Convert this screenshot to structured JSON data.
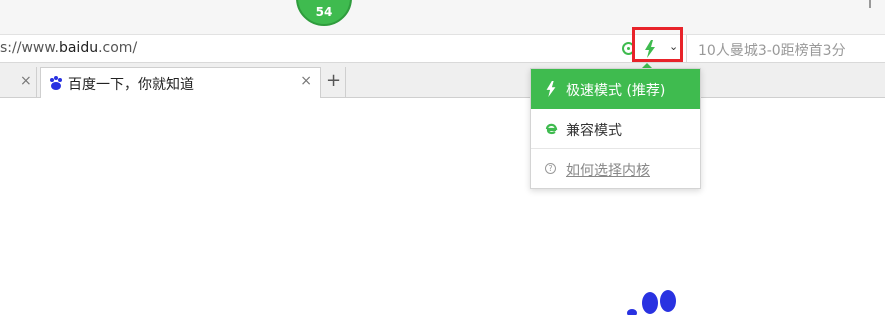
{
  "top_bar": {
    "badge_count": "54"
  },
  "address_bar": {
    "url_prefix": "s://www.",
    "url_host": "baidu",
    "url_suffix": ".com/",
    "search_text": "10人曼城3-0距榜首3分"
  },
  "tabs": {
    "items": [
      {
        "title": "百度一下，你就知道",
        "active": true
      }
    ],
    "close_glyph": "×",
    "new_tab_glyph": "+"
  },
  "mode_menu": {
    "items": [
      {
        "label": "极速模式 (推荐)",
        "selected": true,
        "icon": "bolt-icon"
      },
      {
        "label": "兼容模式",
        "selected": false,
        "icon": "ie-icon"
      },
      {
        "label": "如何选择内核",
        "selected": false,
        "icon": "help-icon"
      }
    ]
  },
  "colors": {
    "accent_green": "#3fbb4f",
    "highlight_red": "#e8232a",
    "baidu_blue": "#2932e1"
  },
  "icons": {
    "mode_caret": "chevron-down-icon",
    "refresh": "refresh-icon"
  }
}
